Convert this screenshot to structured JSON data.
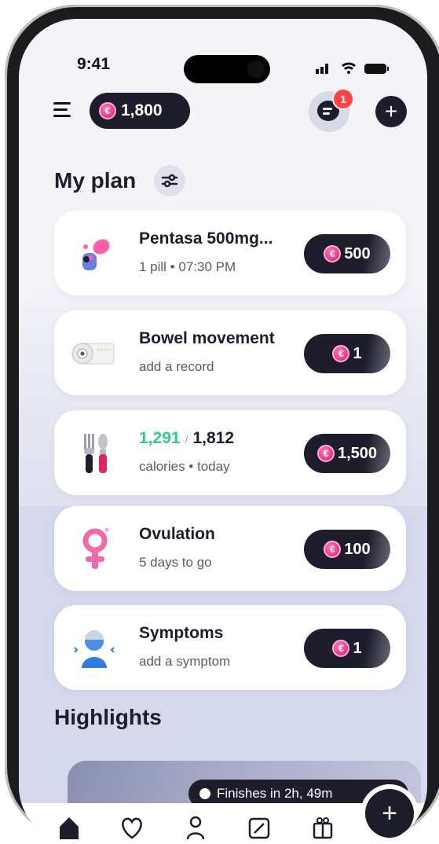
{
  "status_bar": {
    "time": "9:41"
  },
  "header": {
    "coins": "1,800",
    "notification_count": "1"
  },
  "plan": {
    "title": "My plan",
    "items": [
      {
        "title": "Pentasa 500mg...",
        "subtitle": "1 pill • 07:30 PM",
        "reward": "500",
        "icon": "pill-icon"
      },
      {
        "title": "Bowel movement",
        "subtitle": "add a record",
        "reward": "1",
        "icon": "toilet-paper-icon"
      },
      {
        "title_current": "1,291",
        "title_sep": "/",
        "title_total": "1,812",
        "subtitle": "calories • today",
        "reward": "1,500",
        "icon": "fork-knife-icon"
      },
      {
        "title": "Ovulation",
        "subtitle": "5 days to go",
        "reward": "100",
        "icon": "female-symbol-icon"
      },
      {
        "title": "Symptoms",
        "subtitle": "add a symptom",
        "reward": "1",
        "icon": "person-icon"
      }
    ]
  },
  "highlights": {
    "title": "Highlights",
    "timer": "Finishes in 2h, 49m"
  },
  "tabbar": {
    "items": [
      "home-icon",
      "heart-icon",
      "symptoms-icon",
      "coupon-icon",
      "gift-icon"
    ]
  },
  "colors": {
    "accent_dark": "#1d1d2b",
    "coin": "#e5127a",
    "calories_green": "#2ecc8a",
    "badge_red": "#ff4343"
  }
}
